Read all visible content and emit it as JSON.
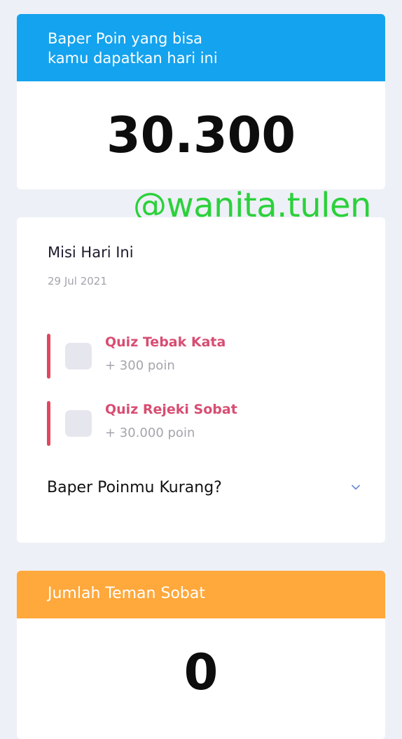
{
  "points_card": {
    "header_line1": "Baper Poin yang bisa",
    "header_line2": "kamu dapatkan hari ini",
    "value": "30.300",
    "header_color": "#14a3ee"
  },
  "watermark": "@wanita.tulen",
  "missions_card": {
    "title": "Misi Hari Ini",
    "date": "29 Jul 2021",
    "missions": [
      {
        "title": "Quiz Tebak Kata",
        "reward": "+ 300 poin"
      },
      {
        "title": "Quiz Rejeki Sobat",
        "reward": "+ 30.000 poin"
      }
    ],
    "accordion_label": "Baper Poinmu Kurang?",
    "accordion_icon": "chevron-down-icon",
    "accent_color": "#e0475f"
  },
  "friends_card": {
    "header": "Jumlah Teman Sobat",
    "value": "0",
    "header_color": "#ffa83b"
  }
}
